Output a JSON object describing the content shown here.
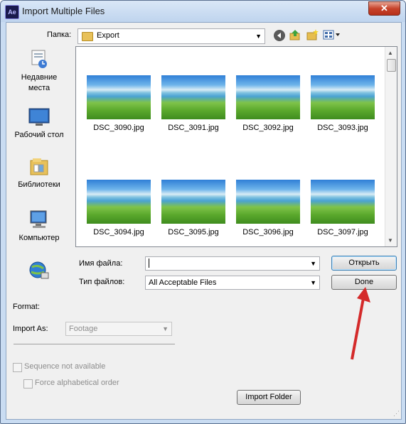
{
  "window": {
    "title": "Import Multiple Files",
    "app_icon_text": "Ae",
    "close_symbol": "✕"
  },
  "toolbar": {
    "folder_label": "Папка:",
    "current_folder": "Export",
    "icons": [
      "back-icon",
      "up-folder-icon",
      "new-folder-icon",
      "view-menu-icon"
    ]
  },
  "places": [
    {
      "label": "Недавние места",
      "icon": "recent-places-icon"
    },
    {
      "label": "Рабочий стол",
      "icon": "desktop-icon"
    },
    {
      "label": "Библиотеки",
      "icon": "libraries-icon"
    },
    {
      "label": "Компьютер",
      "icon": "computer-icon"
    },
    {
      "label": "",
      "icon": "network-icon"
    }
  ],
  "files": [
    "DSC_3090.jpg",
    "DSC_3091.jpg",
    "DSC_3092.jpg",
    "DSC_3093.jpg",
    "DSC_3094.jpg",
    "DSC_3095.jpg",
    "DSC_3096.jpg",
    "DSC_3097.jpg"
  ],
  "filename_row": {
    "label": "Имя файла:",
    "value": ""
  },
  "filetype_row": {
    "label": "Тип файлов:",
    "value": "All Acceptable Files"
  },
  "buttons": {
    "open": "Открыть",
    "done": "Done",
    "import_folder": "Import Folder"
  },
  "format": {
    "label": "Format:"
  },
  "import_as": {
    "label": "Import As:",
    "value": "Footage"
  },
  "options": {
    "sequence_label": "Sequence not available",
    "alpha_order_label": "Force alphabetical order"
  },
  "colors": {
    "annotation_arrow": "#d42a2a",
    "title_bar": "#c9dcf2"
  }
}
